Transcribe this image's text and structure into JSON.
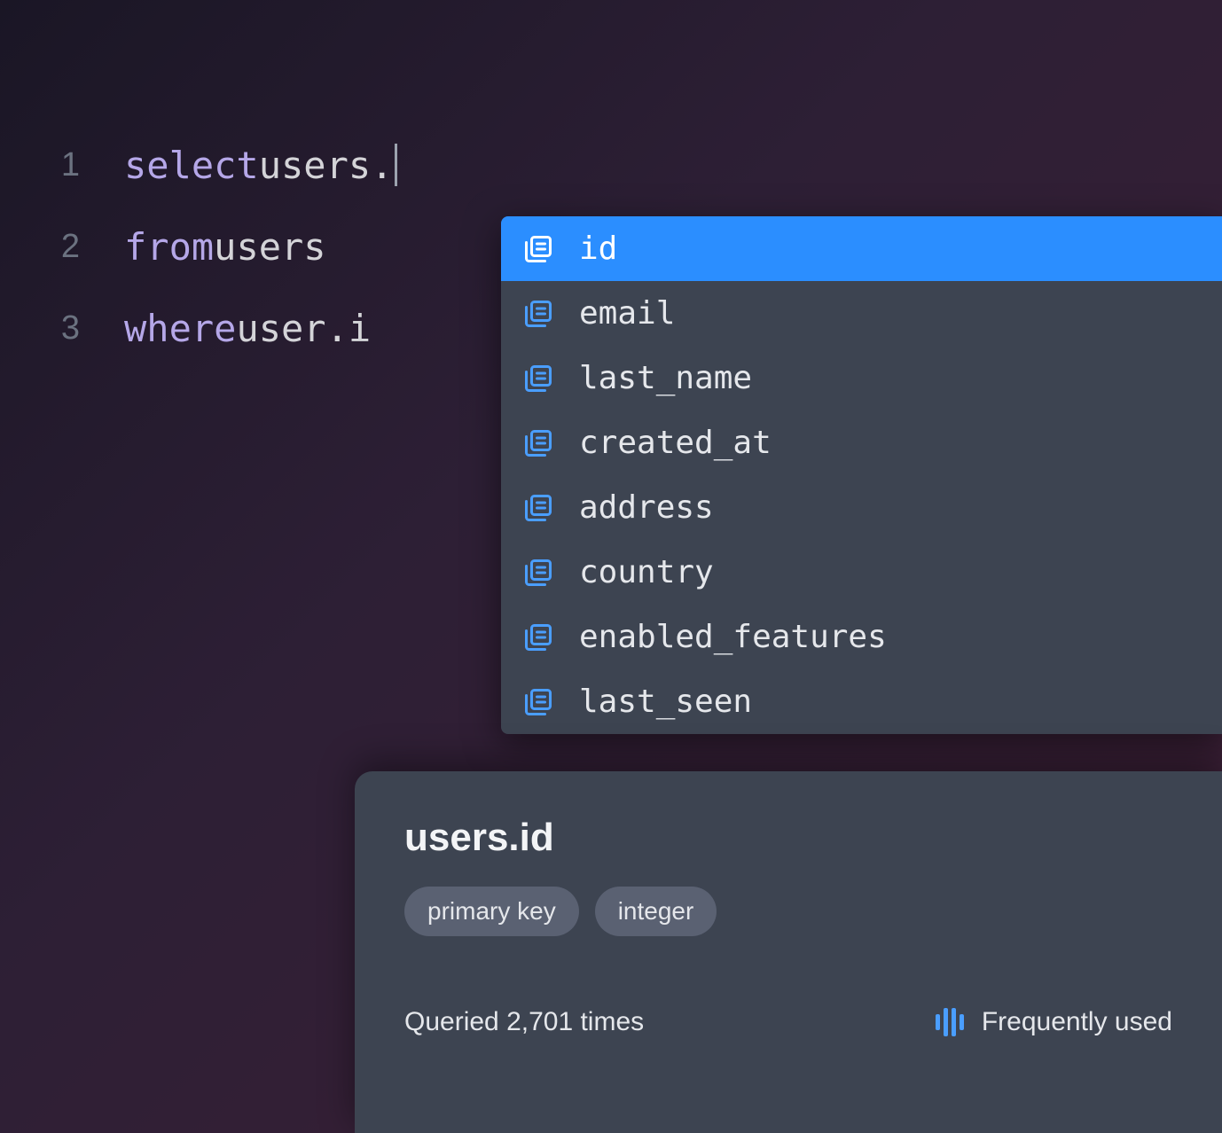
{
  "editor": {
    "lines": [
      {
        "number": "1",
        "keyword": "select",
        "rest": " users."
      },
      {
        "number": "2",
        "keyword": "from",
        "rest": " users"
      },
      {
        "number": "3",
        "keyword": "where",
        "rest": " user.i"
      }
    ]
  },
  "autocomplete": {
    "items": [
      {
        "label": "id",
        "selected": true
      },
      {
        "label": "email",
        "selected": false
      },
      {
        "label": "last_name",
        "selected": false
      },
      {
        "label": "created_at",
        "selected": false
      },
      {
        "label": "address",
        "selected": false
      },
      {
        "label": "country",
        "selected": false
      },
      {
        "label": "enabled_features",
        "selected": false
      },
      {
        "label": "last_seen",
        "selected": false
      }
    ]
  },
  "detail": {
    "title": "users.id",
    "badges": [
      "primary key",
      "integer"
    ],
    "query_count_label": "Queried 2,701 times",
    "frequency_label": "Frequently used"
  }
}
